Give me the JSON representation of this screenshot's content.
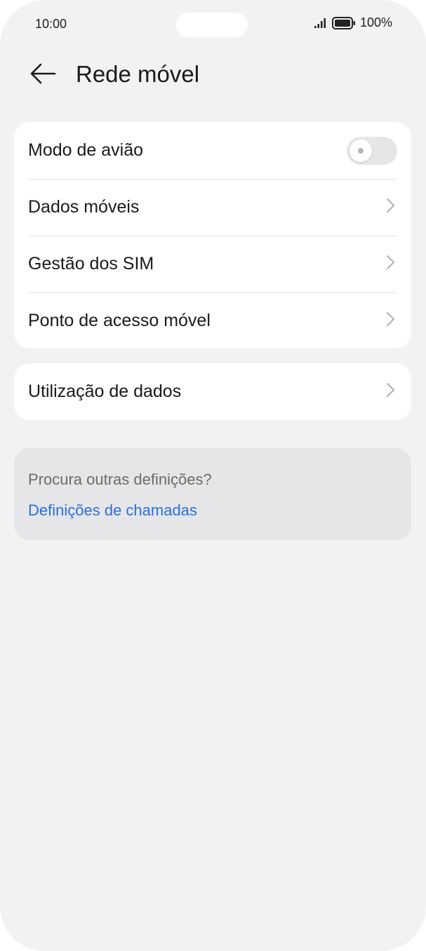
{
  "status_bar": {
    "time": "10:00",
    "battery": "100%",
    "signal_icon": "signal-icon",
    "battery_icon": "battery-icon"
  },
  "header": {
    "title": "Rede móvel",
    "back_icon": "arrow-left-icon"
  },
  "card1": {
    "items": [
      {
        "label": "Modo de avião",
        "control": "toggle",
        "toggle_on": false
      },
      {
        "label": "Dados móveis",
        "control": "chevron"
      },
      {
        "label": "Gestão dos SIM",
        "control": "chevron"
      },
      {
        "label": "Ponto de acesso móvel",
        "control": "chevron"
      }
    ]
  },
  "card2": {
    "items": [
      {
        "label": "Utilização de dados",
        "control": "chevron"
      }
    ]
  },
  "suggestion": {
    "text": "Procura outras definições?",
    "link": "Definições de chamadas"
  },
  "colors": {
    "background": "#f1f2f4",
    "card": "#ffffff",
    "link": "#2a6fdb",
    "suggestion_bg": "#e6e6e8"
  }
}
